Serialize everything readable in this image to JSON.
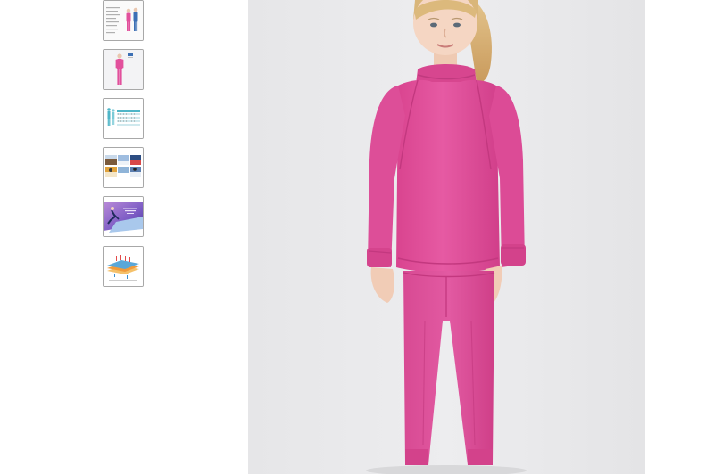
{
  "gallery": {
    "thumbnails": [
      {
        "icon": "size-info-thumbnail-icon",
        "description_name": "thumbnail-1"
      },
      {
        "icon": "girl-pink-thermal-thumbnail-icon",
        "description_name": "thumbnail-2"
      },
      {
        "icon": "size-chart-thumbnail-icon",
        "description_name": "thumbnail-3"
      },
      {
        "icon": "winter-sports-collage-thumbnail-icon",
        "description_name": "thumbnail-4"
      },
      {
        "icon": "skater-banner-thumbnail-icon",
        "description_name": "thumbnail-5"
      },
      {
        "icon": "fabric-layers-thumbnail-icon",
        "description_name": "thumbnail-6"
      }
    ],
    "main_image_icon": "child-in-pink-thermal-underwear-photo",
    "colors": {
      "garment_pink": "#e2509c",
      "garment_shadow": "#c9357f",
      "background_gray": "#e9e9eb",
      "hair": "#d8b478",
      "skin": "#f3d3bf",
      "thumb_border": "#a8a8a8"
    }
  }
}
